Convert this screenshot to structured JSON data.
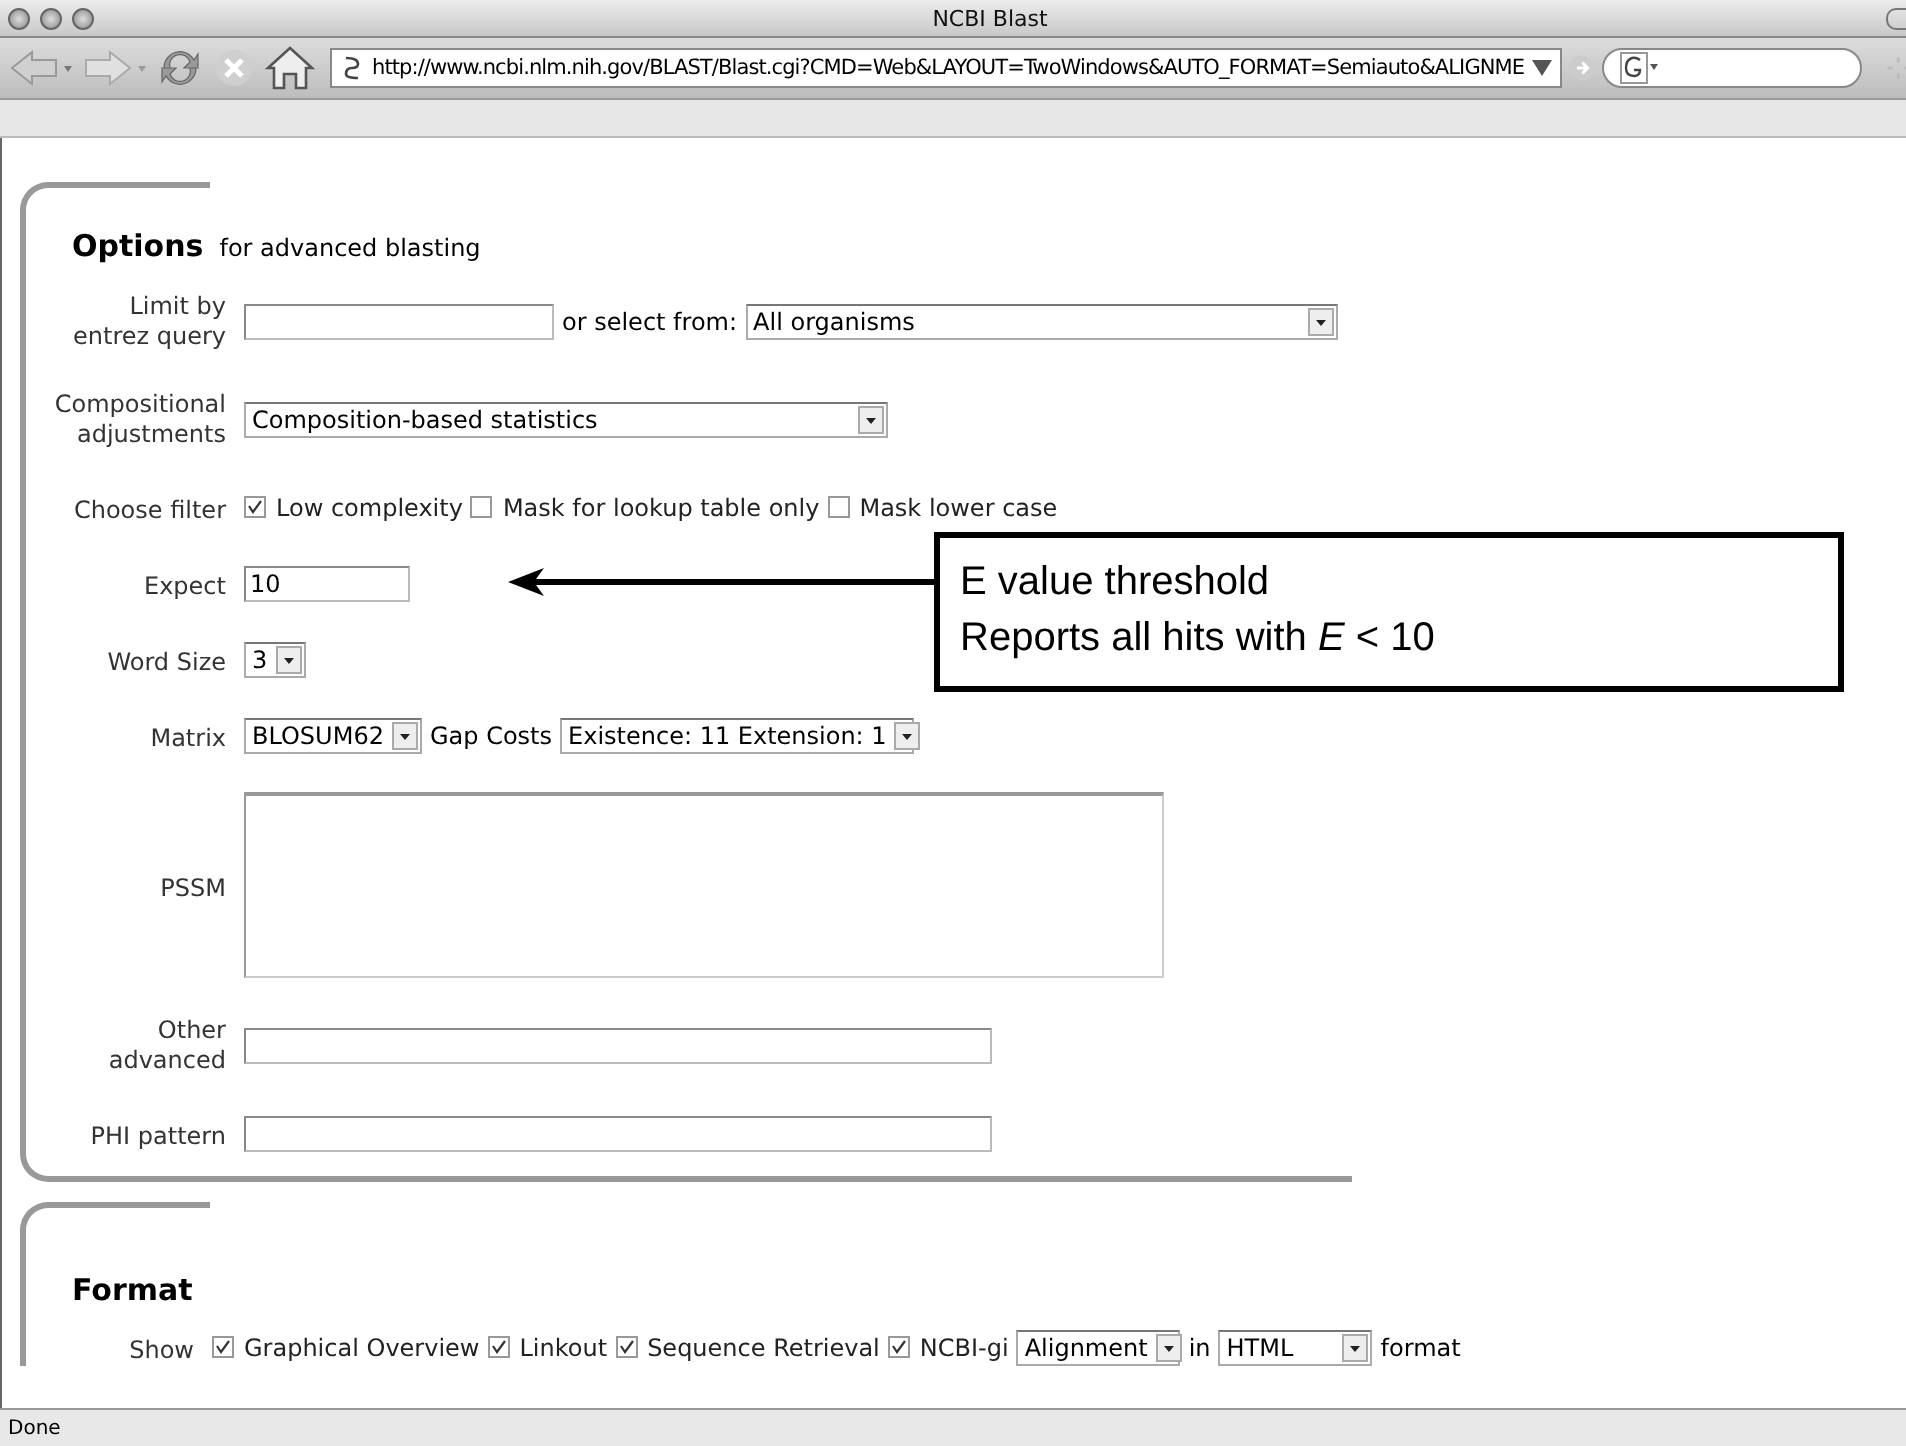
{
  "window": {
    "title": "NCBI Blast"
  },
  "toolbar": {
    "url": "http://www.ncbi.nlm.nih.gov/BLAST/Blast.cgi?CMD=Web&LAYOUT=TwoWindows&AUTO_FORMAT=Semiauto&ALIGNME"
  },
  "options": {
    "heading": "Options",
    "subheading": "for advanced blasting",
    "rows": [
      {
        "label_lines": [
          "Limit by",
          "entrez query"
        ],
        "controls": [
          {
            "kind": "field"
          },
          {
            "kind": "text",
            "text": "or select from:"
          },
          {
            "kind": "select",
            "value": "All organisms"
          }
        ]
      },
      {
        "label_lines": [
          "Compositional",
          "adjustments"
        ],
        "controls": [
          {
            "kind": "select",
            "value": "Composition-based statistics"
          }
        ]
      },
      {
        "label_lines": [
          "Choose filter"
        ],
        "controls": [
          {
            "kind": "check",
            "label": "Low complexity",
            "checked": true
          },
          {
            "kind": "check",
            "label": "Mask for lookup table only",
            "checked": false
          },
          {
            "kind": "check",
            "label": "Mask lower case",
            "checked": false
          }
        ]
      },
      {
        "label_lines": [
          "Expect"
        ],
        "controls": [
          {
            "kind": "field",
            "value": "10"
          }
        ]
      },
      {
        "label_lines": [
          "Word Size"
        ],
        "controls": [
          {
            "kind": "select",
            "value": "3"
          }
        ]
      },
      {
        "label_lines": [
          "Matrix"
        ],
        "controls": [
          {
            "kind": "select",
            "value": "BLOSUM62"
          },
          {
            "kind": "text",
            "text": "Gap Costs"
          },
          {
            "kind": "select",
            "value": "Existence: 11 Extension: 1"
          }
        ]
      },
      {
        "label_lines": [
          "PSSM"
        ],
        "controls": [
          {
            "kind": "area"
          }
        ]
      },
      {
        "label_lines": [
          "Other",
          "advanced"
        ],
        "controls": [
          {
            "kind": "field"
          }
        ]
      },
      {
        "label_lines": [
          "PHI pattern"
        ],
        "controls": [
          {
            "kind": "field"
          }
        ]
      }
    ]
  },
  "format": {
    "heading": "Format",
    "rows": [
      {
        "label_lines": [
          "Show"
        ],
        "controls": [
          {
            "kind": "check",
            "label": "Graphical Overview",
            "checked": true
          },
          {
            "kind": "check",
            "label": "Linkout",
            "checked": true
          },
          {
            "kind": "check",
            "label": "Sequence Retrieval",
            "checked": true
          },
          {
            "kind": "check",
            "label": "NCBI-gi",
            "checked": true
          },
          {
            "kind": "select",
            "value": "Alignment"
          },
          {
            "kind": "text",
            "text": "in"
          },
          {
            "kind": "select",
            "value": "HTML"
          },
          {
            "kind": "text",
            "text": "format"
          }
        ]
      }
    ]
  },
  "annotation": {
    "lines": [
      "E value threshold",
      "Reports all hits with *E* < 10"
    ]
  },
  "status_bar": {
    "text": "Done"
  }
}
